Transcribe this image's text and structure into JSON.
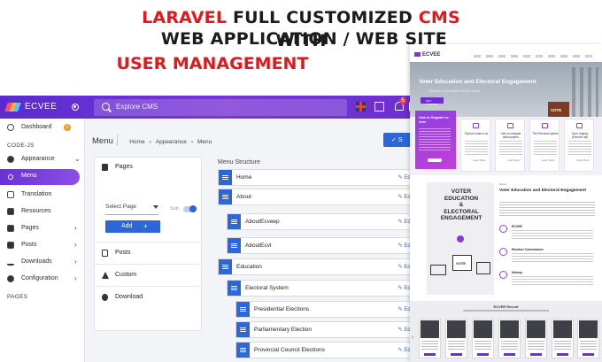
{
  "headline": {
    "l1_red": "LARAVEL",
    "l1_black": " FULL CUSTOMIZED ",
    "l1_red2": "CMS",
    "l1_black2": " WEB APPLICATION / WEB SITE",
    "l2": "WITH",
    "l3": "USER MANAGEMENT"
  },
  "admin": {
    "brand": "ECVEE",
    "search_placeholder": "Explore CMS",
    "notification_count": "5",
    "sidebar": {
      "dashboard": "Dashboard",
      "dashboard_badge": "2",
      "section_code": "CODE-JS",
      "appearance": "Appearance",
      "menu": "Menu",
      "translation": "Translation",
      "resources": "Resources",
      "pages": "Pages",
      "posts": "Posts",
      "downloads": "Downloads",
      "configuration": "Configuration",
      "section_pages": "PAGES"
    },
    "breadcrumb": {
      "title": "Menu",
      "home": "Home",
      "appearance": "Appearance",
      "menu": "Menu"
    },
    "save_label": "S",
    "left_panel": {
      "pages": "Pages",
      "select_page": "Select Page",
      "sub": "Sub",
      "add": "Add",
      "add_plus": "+",
      "posts": "Posts",
      "custom": "Custom",
      "download": "Download"
    },
    "structure": {
      "title": "Menu Structure",
      "edit_label": "Edi",
      "items": [
        "Home",
        "About",
        "AboutEcveep",
        "AboutEcvl",
        "Education",
        "Electoral System",
        "Presidential Elections",
        "Parliamentary Election",
        "Provincial Council Elections"
      ]
    }
  },
  "site": {
    "brand": "ECVEE",
    "hero_title": "Voter Education and Electoral Engagement",
    "hero_sub": "Election Commission of Sri Lanka",
    "hero_button": "GET STARTED",
    "hero_vote": "VOTE",
    "promo_title": "How to Register to Vote",
    "cards": [
      {
        "title": "Explore what to do"
      },
      {
        "title": "How to navigate ballot papers"
      },
      {
        "title": "The Electoral system"
      },
      {
        "title": "Voter registry (Election list)"
      }
    ],
    "card_more": "Learn More",
    "about_small": "About",
    "about_title": "Voter Education and Electoral Engagement",
    "about_image_line1": "VOTER",
    "about_image_line2": "EDUCATION",
    "about_image_line3": "&",
    "about_image_line4": "ELECTORAL",
    "about_image_line5": "ENGAGEMENT",
    "about_vote": "VOTE",
    "features": [
      "ECVEE",
      "Election Commission",
      "History"
    ],
    "recent_title": "ECVEE Recent"
  }
}
